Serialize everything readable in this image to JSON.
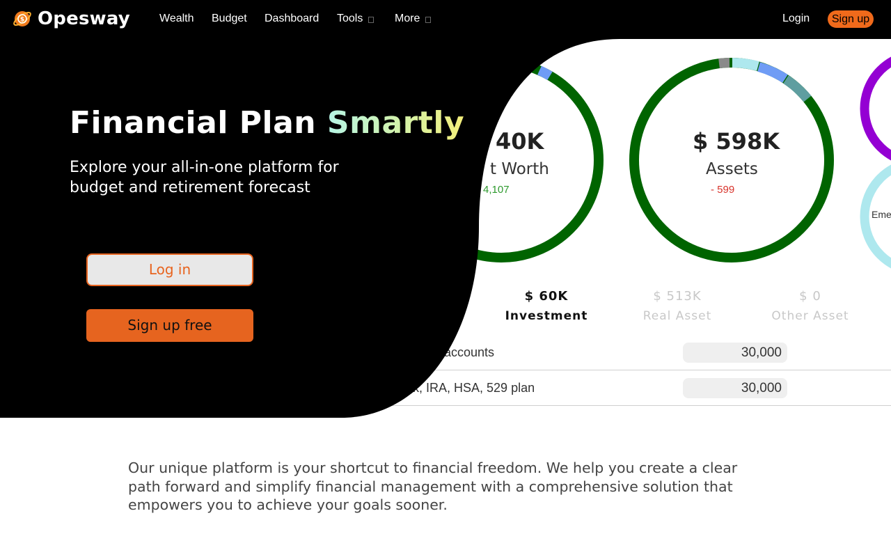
{
  "brand": {
    "name": "Opesway"
  },
  "nav": {
    "items": [
      {
        "label": "Wealth"
      },
      {
        "label": "Budget"
      },
      {
        "label": "Dashboard"
      },
      {
        "label": "Tools",
        "has_dropdown": true
      },
      {
        "label": "More",
        "has_dropdown": true
      }
    ],
    "login": "Login",
    "signup": "Sign up"
  },
  "hero": {
    "title_plain": "Financial Plan ",
    "title_highlight": "Smartly",
    "subtitle": "Explore your all-in-one platform for budget and retirement forecast",
    "login_button": "Log in",
    "signup_button": "Sign up free"
  },
  "dashboard": {
    "rings": [
      {
        "amount": "40K",
        "label": "t Worth",
        "delta": "4,107",
        "delta_color": "#2e9a2e"
      },
      {
        "amount": "$ 598K",
        "label": "Assets",
        "delta": "- 599",
        "delta_color": "#d8342c"
      },
      {
        "label": "Eme"
      }
    ],
    "categories": [
      {
        "amount": "$ 60K",
        "name": "Investment",
        "active": true
      },
      {
        "amount": "$ 513K",
        "name": "Real Asset",
        "active": false
      },
      {
        "amount": "$ 0",
        "name": "Other Asset",
        "active": false
      }
    ],
    "rows": [
      {
        "label": "accounts",
        "value": "30,000"
      },
      {
        "label": "1k, IRA, HSA, 529 plan",
        "value": "30,000"
      }
    ]
  },
  "blurb": "Our unique platform is your shortcut to financial freedom. We help you create a clear path forward and simplify financial management with a comprehensive solution that empowers you to achieve your goals sooner.",
  "colors": {
    "accent": "#e6641f",
    "ring_green": "#006400",
    "ring_purple": "#9400d3",
    "ring_cyan": "#aee8ee"
  }
}
